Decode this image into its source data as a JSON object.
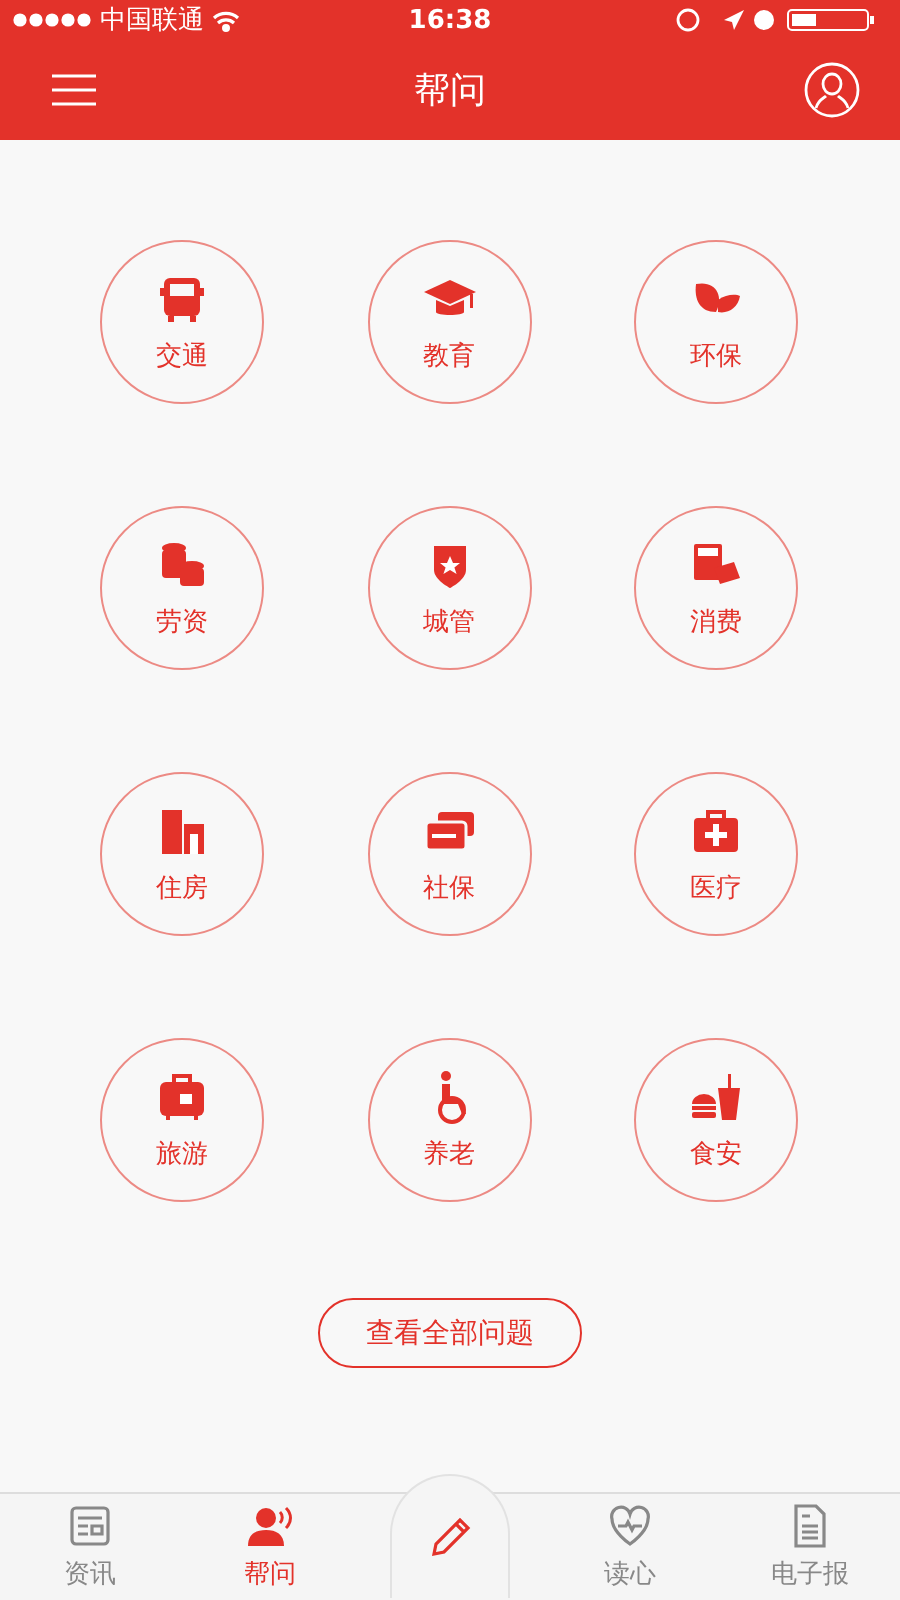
{
  "status_bar": {
    "carrier": "中国联通",
    "time": "16:38"
  },
  "nav": {
    "title": "帮问"
  },
  "categories": [
    {
      "label": "交通"
    },
    {
      "label": "教育"
    },
    {
      "label": "环保"
    },
    {
      "label": "劳资"
    },
    {
      "label": "城管"
    },
    {
      "label": "消费"
    },
    {
      "label": "住房"
    },
    {
      "label": "社保"
    },
    {
      "label": "医疗"
    },
    {
      "label": "旅游"
    },
    {
      "label": "养老"
    },
    {
      "label": "食安"
    }
  ],
  "view_all_button": "查看全部问题",
  "tabs": [
    {
      "label": "资讯",
      "selected": false
    },
    {
      "label": "帮问",
      "selected": true
    },
    {
      "kind": "compose",
      "selected": false
    },
    {
      "label": "读心",
      "selected": false
    },
    {
      "label": "电子报",
      "selected": false
    }
  ]
}
